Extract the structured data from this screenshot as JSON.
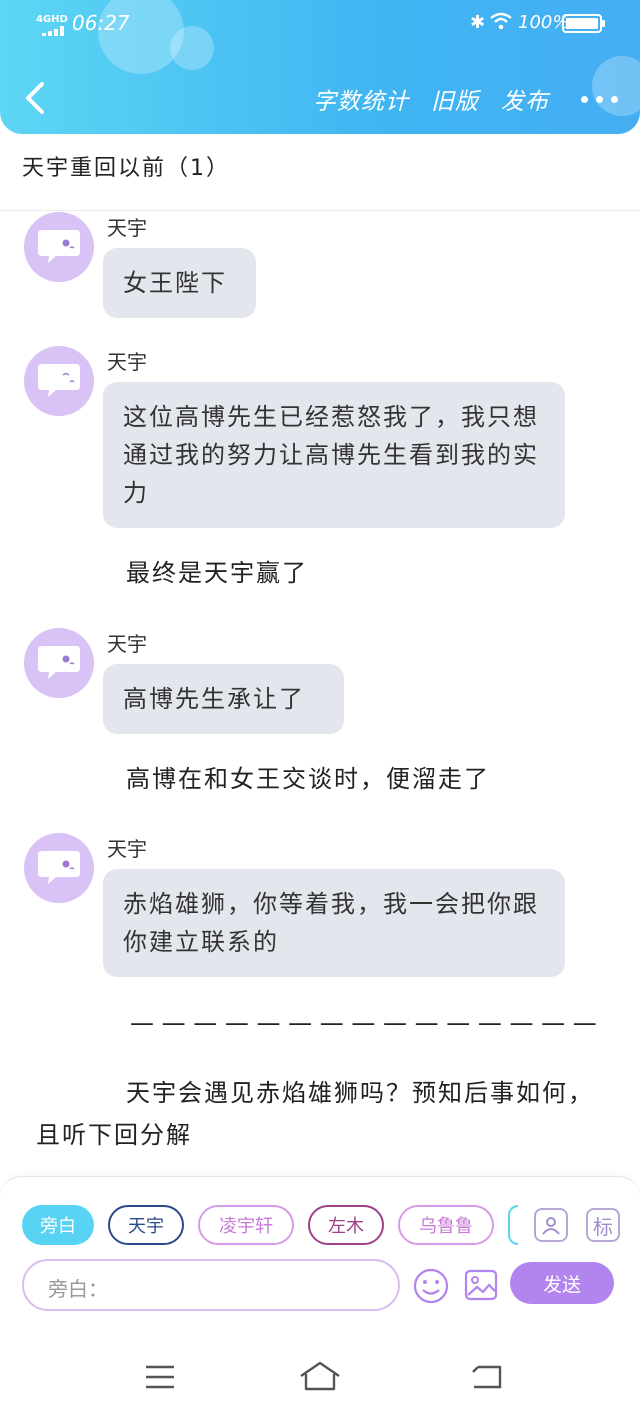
{
  "status_bar": {
    "network": "4GHD",
    "time": "06:27",
    "battery": "100%"
  },
  "header": {
    "actions": [
      "字数统计",
      "旧版",
      "发布"
    ],
    "more_icon": "more-icon",
    "back_icon": "chevron-left-icon"
  },
  "chapter": {
    "title": "天宇重回以前（1）"
  },
  "messages": [
    {
      "sender": "天宇",
      "text": "女王陛下"
    },
    {
      "sender": "天宇",
      "text": "这位高博先生已经惹怒我了，我只想通过我的努力让高博先生看到我的实力"
    },
    {
      "sender": "天宇",
      "text": "高博先生承让了"
    },
    {
      "sender": "天宇",
      "text": "赤焰雄狮，你等着我，我一会把你跟你建立联系的"
    }
  ],
  "narrations": [
    "最终是天宇赢了",
    "高博在和女王交谈时，便溜走了",
    "— — — — — — — — — — — — — — —",
    "天宇会遇见赤焰雄狮吗？预知后事如何，且听下回分解"
  ],
  "composer": {
    "roles": [
      "旁白",
      "天宇",
      "凌宇轩",
      "左木",
      "乌鲁鲁"
    ],
    "role_colors": [
      "#58d3f3",
      "#2b4a8a",
      "#d79be8",
      "#a0408a",
      "#c77ad8"
    ],
    "role_icon_label": "标",
    "input_placeholder": "旁白：",
    "send_label": "发送"
  },
  "colors": {
    "header_gradient_start": "#5dd6f4",
    "header_gradient_end": "#45aef3",
    "bubble_bg": "#e3e6ec",
    "avatar_bg": "#d9c2f5",
    "send_bg": "#b184ee"
  }
}
